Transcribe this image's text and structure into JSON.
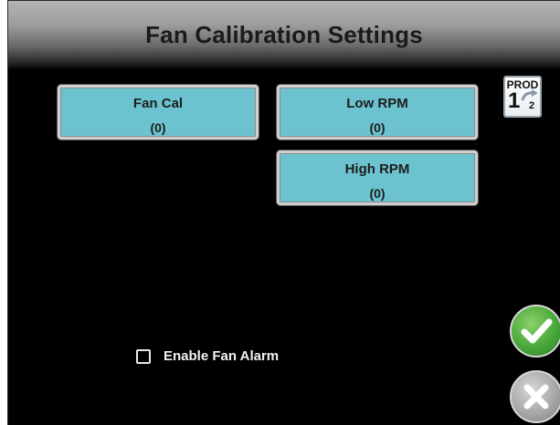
{
  "header": {
    "title": "Fan Calibration Settings"
  },
  "buttons": {
    "fan_cal": {
      "label": "Fan Cal",
      "value": "(0)"
    },
    "low_rpm": {
      "label": "Low RPM",
      "value": "(0)"
    },
    "high_rpm": {
      "label": "High RPM",
      "value": "(0)"
    }
  },
  "product_toggle": {
    "label": "PROD",
    "current": "1",
    "next": "2"
  },
  "options": {
    "enable_fan_alarm": {
      "label": "Enable Fan Alarm",
      "checked": false
    }
  },
  "actions": {
    "accept_icon": "checkmark-icon",
    "cancel_icon": "x-icon",
    "accept_color": "#4aa83a",
    "cancel_color": "#a8a8a8"
  },
  "colors": {
    "button_fill": "#6cc3cf",
    "background": "#000000"
  }
}
